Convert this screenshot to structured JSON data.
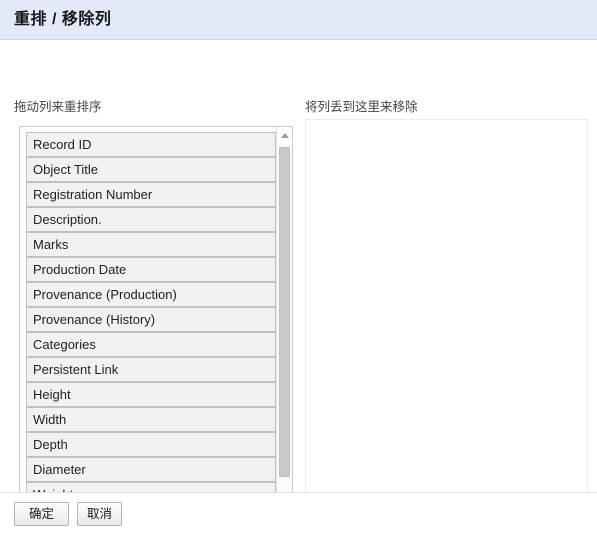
{
  "dialog": {
    "title": "重排 / 移除列",
    "header_bg": "#e3eaf7"
  },
  "panels": {
    "reorder_label": "拖动列来重排序",
    "remove_label": "将列丢到这里来移除"
  },
  "columns": [
    "Record ID",
    "Object Title",
    "Registration Number",
    "Description.",
    "Marks",
    "Production Date",
    "Provenance (Production)",
    "Provenance (History)",
    "Categories",
    "Persistent Link",
    "Height",
    "Width",
    "Depth",
    "Diameter",
    "Weight",
    ""
  ],
  "scrollbar": {
    "up_arrow": "scroll-up-arrow",
    "down_arrow": "scroll-down-arrow"
  },
  "footer": {
    "ok_label": "确定",
    "cancel_label": "取消"
  }
}
